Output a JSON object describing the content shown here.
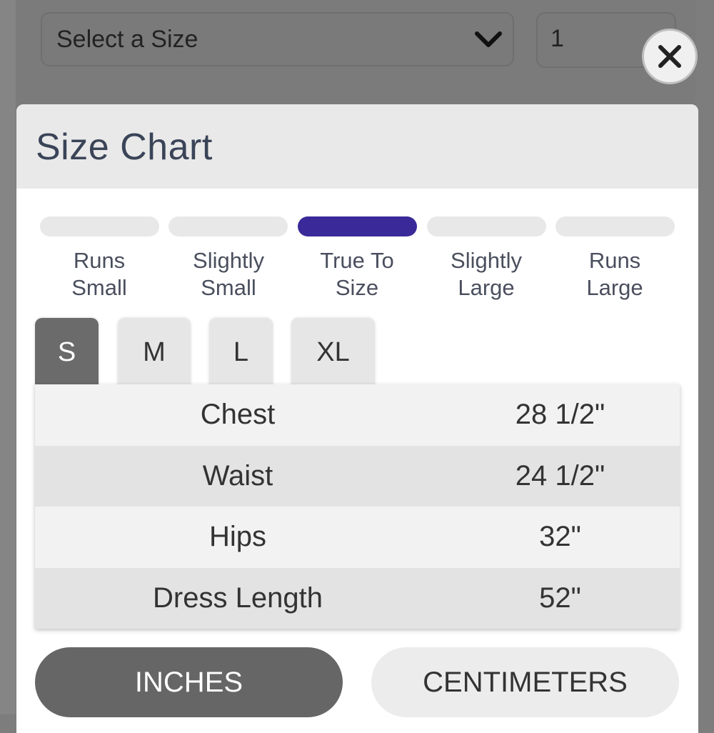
{
  "background": {
    "size_select_label": "Select a Size",
    "quantity_value": "1"
  },
  "modal": {
    "title": "Size Chart",
    "fit_scale": {
      "options": [
        "Runs\nSmall",
        "Slightly\nSmall",
        "True To\nSize",
        "Slightly\nLarge",
        "Runs\nLarge"
      ],
      "selected_index": 2,
      "accent_color": "#3a2a99"
    },
    "size_tabs": [
      {
        "label": "S",
        "active": true
      },
      {
        "label": "M",
        "active": false
      },
      {
        "label": "L",
        "active": false
      },
      {
        "label": "XL",
        "active": false
      }
    ],
    "measurements": [
      {
        "label": "Chest",
        "value": "28 1/2\""
      },
      {
        "label": "Waist",
        "value": "24 1/2\""
      },
      {
        "label": "Hips",
        "value": "32\""
      },
      {
        "label": "Dress Length",
        "value": "52\""
      }
    ],
    "units": {
      "inches_label": "INCHES",
      "centimeters_label": "CENTIMETERS",
      "selected": "INCHES"
    }
  },
  "icons": {
    "close": "close-icon",
    "dropdown": "chevron-down-icon"
  }
}
